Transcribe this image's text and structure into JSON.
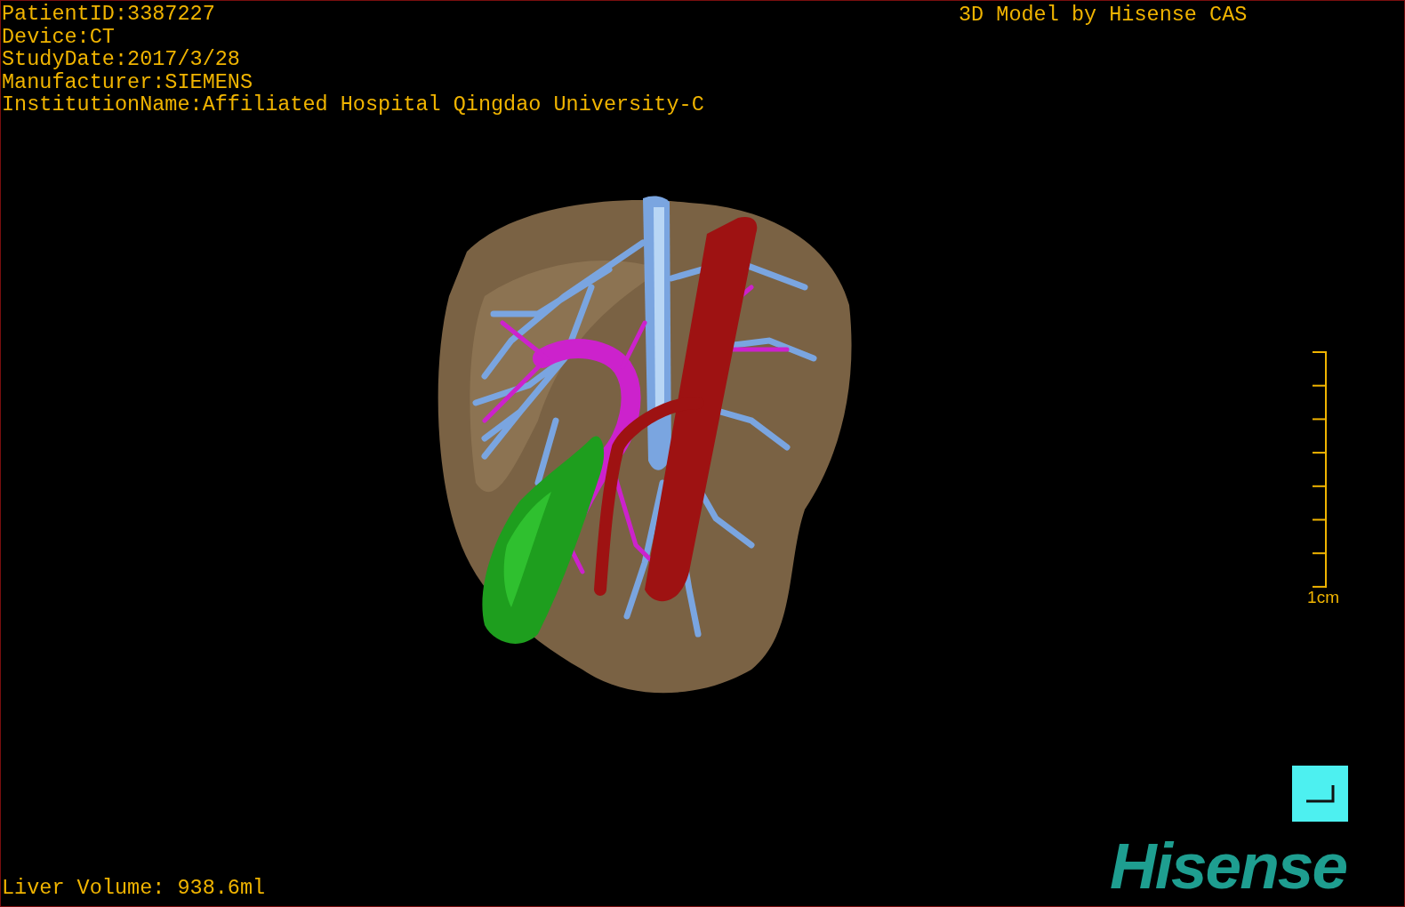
{
  "header_lines": [
    "PatientID:3387227",
    "Device:CT",
    "StudyDate:2017/3/28",
    "Manufacturer:SIEMENS",
    "InstitutionName:Affiliated Hospital Qingdao University-C"
  ],
  "model_credit": "3D Model by Hisense CAS",
  "scale_bar": {
    "label": "1cm"
  },
  "liver_volume": "Liver Volume: 938.6ml",
  "logo": "Hisense"
}
